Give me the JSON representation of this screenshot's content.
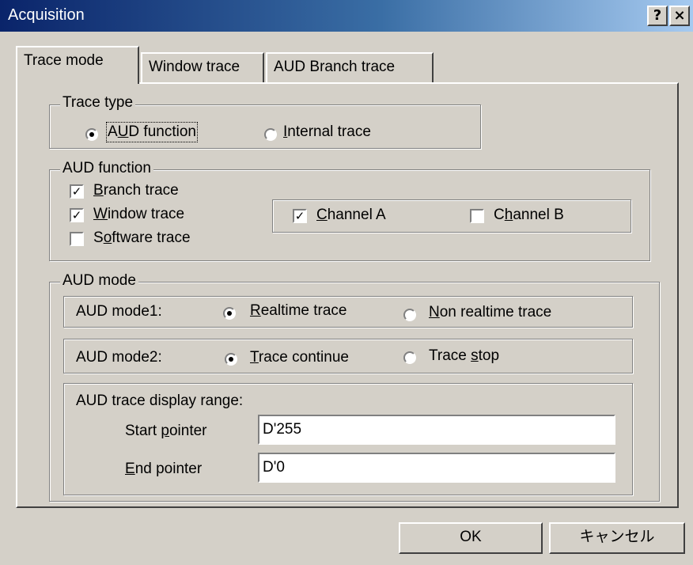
{
  "window": {
    "title": "Acquisition",
    "help_button": "?",
    "close_button": "×"
  },
  "tabs": [
    "Trace mode",
    "Window trace",
    "AUD Branch trace"
  ],
  "trace_type": {
    "legend": "Trace type",
    "options": [
      {
        "label": "AUD function",
        "selected": true
      },
      {
        "label": "Internal trace",
        "selected": false
      }
    ]
  },
  "aud_function": {
    "legend": "AUD function",
    "branch_trace": {
      "label": "Branch trace",
      "checked": true
    },
    "window_trace": {
      "label": "Window trace",
      "checked": true
    },
    "software_trace": {
      "label": "Software trace",
      "checked": false
    },
    "channel_a": {
      "label": "Channel A",
      "checked": true
    },
    "channel_b": {
      "label": "Channel B",
      "checked": false
    }
  },
  "aud_mode": {
    "legend": "AUD mode",
    "mode1": {
      "label": "AUD mode1:",
      "options": [
        {
          "label": "Realtime trace",
          "selected": true
        },
        {
          "label": "Non realtime trace",
          "selected": false
        }
      ]
    },
    "mode2": {
      "label": "AUD mode2:",
      "options": [
        {
          "label": "Trace continue",
          "selected": true
        },
        {
          "label": "Trace stop",
          "selected": false
        }
      ]
    },
    "range": {
      "label": "AUD trace display range:",
      "start_label": "Start pointer",
      "start_value": "D'255",
      "end_label": "End pointer",
      "end_value": "D'0"
    }
  },
  "buttons": {
    "ok": "OK",
    "cancel": "キャンセル"
  }
}
